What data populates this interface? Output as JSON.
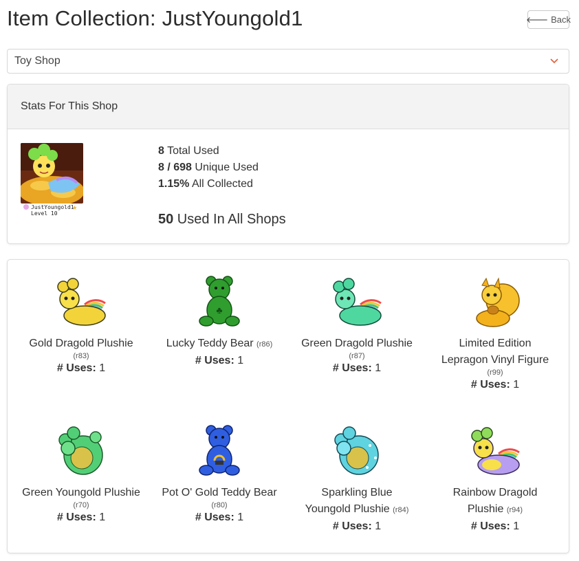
{
  "header": {
    "title": "Item Collection: JustYoungold1",
    "back_label": "Back"
  },
  "shop_select": {
    "selected": "Toy Shop"
  },
  "stats": {
    "heading": "Stats For This Shop",
    "avatar": {
      "username": "JustYoungold1",
      "level": "Level 10"
    },
    "total_used_value": "8",
    "total_used_label": " Total Used",
    "unique_used_value": "8 / 698",
    "unique_used_label": " Unique Used",
    "collected_value": "1.15%",
    "collected_label": " All Collected",
    "all_shops_value": "50",
    "all_shops_label": " Used In All Shops"
  },
  "uses_label": "# Uses:",
  "items": [
    {
      "name": "Gold Dragold Plushie",
      "rarity": "(r83)",
      "uses": "1",
      "icon": "gold-dragold-plushie",
      "color": "#f2d43a"
    },
    {
      "name": "Lucky Teddy Bear",
      "rarity": "(r86)",
      "uses": "1",
      "icon": "lucky-teddy-bear",
      "color": "#2f9e2f"
    },
    {
      "name": "Green Dragold Plushie",
      "rarity": "(r87)",
      "uses": "1",
      "icon": "green-dragold-plushie",
      "color": "#4ed8a0"
    },
    {
      "name_line1": "Limited Edition",
      "name_line2": "Lepragon Vinyl Figure",
      "rarity": "(r99)",
      "uses": "1",
      "icon": "lepragon-vinyl-figure",
      "color": "#f3b11c"
    },
    {
      "name": "Green Youngold Plushie",
      "rarity": "(r70)",
      "uses": "1",
      "icon": "green-youngold-plushie",
      "color": "#52cf76"
    },
    {
      "name": "Pot O' Gold Teddy Bear",
      "rarity": "(r80)",
      "uses": "1",
      "icon": "pot-o-gold-teddy-bear",
      "color": "#2f5fe0"
    },
    {
      "name_line1": "Sparkling Blue",
      "name_line2": "Youngold Plushie",
      "rarity": "(r84)",
      "uses": "1",
      "icon": "sparkling-blue-youngold-plushie",
      "color": "#5fd3e0"
    },
    {
      "name_line1": "Rainbow Dragold",
      "name_line2": "Plushie",
      "rarity": "(r94)",
      "uses": "1",
      "icon": "rainbow-dragold-plushie",
      "color": "#8fdc5a"
    }
  ]
}
